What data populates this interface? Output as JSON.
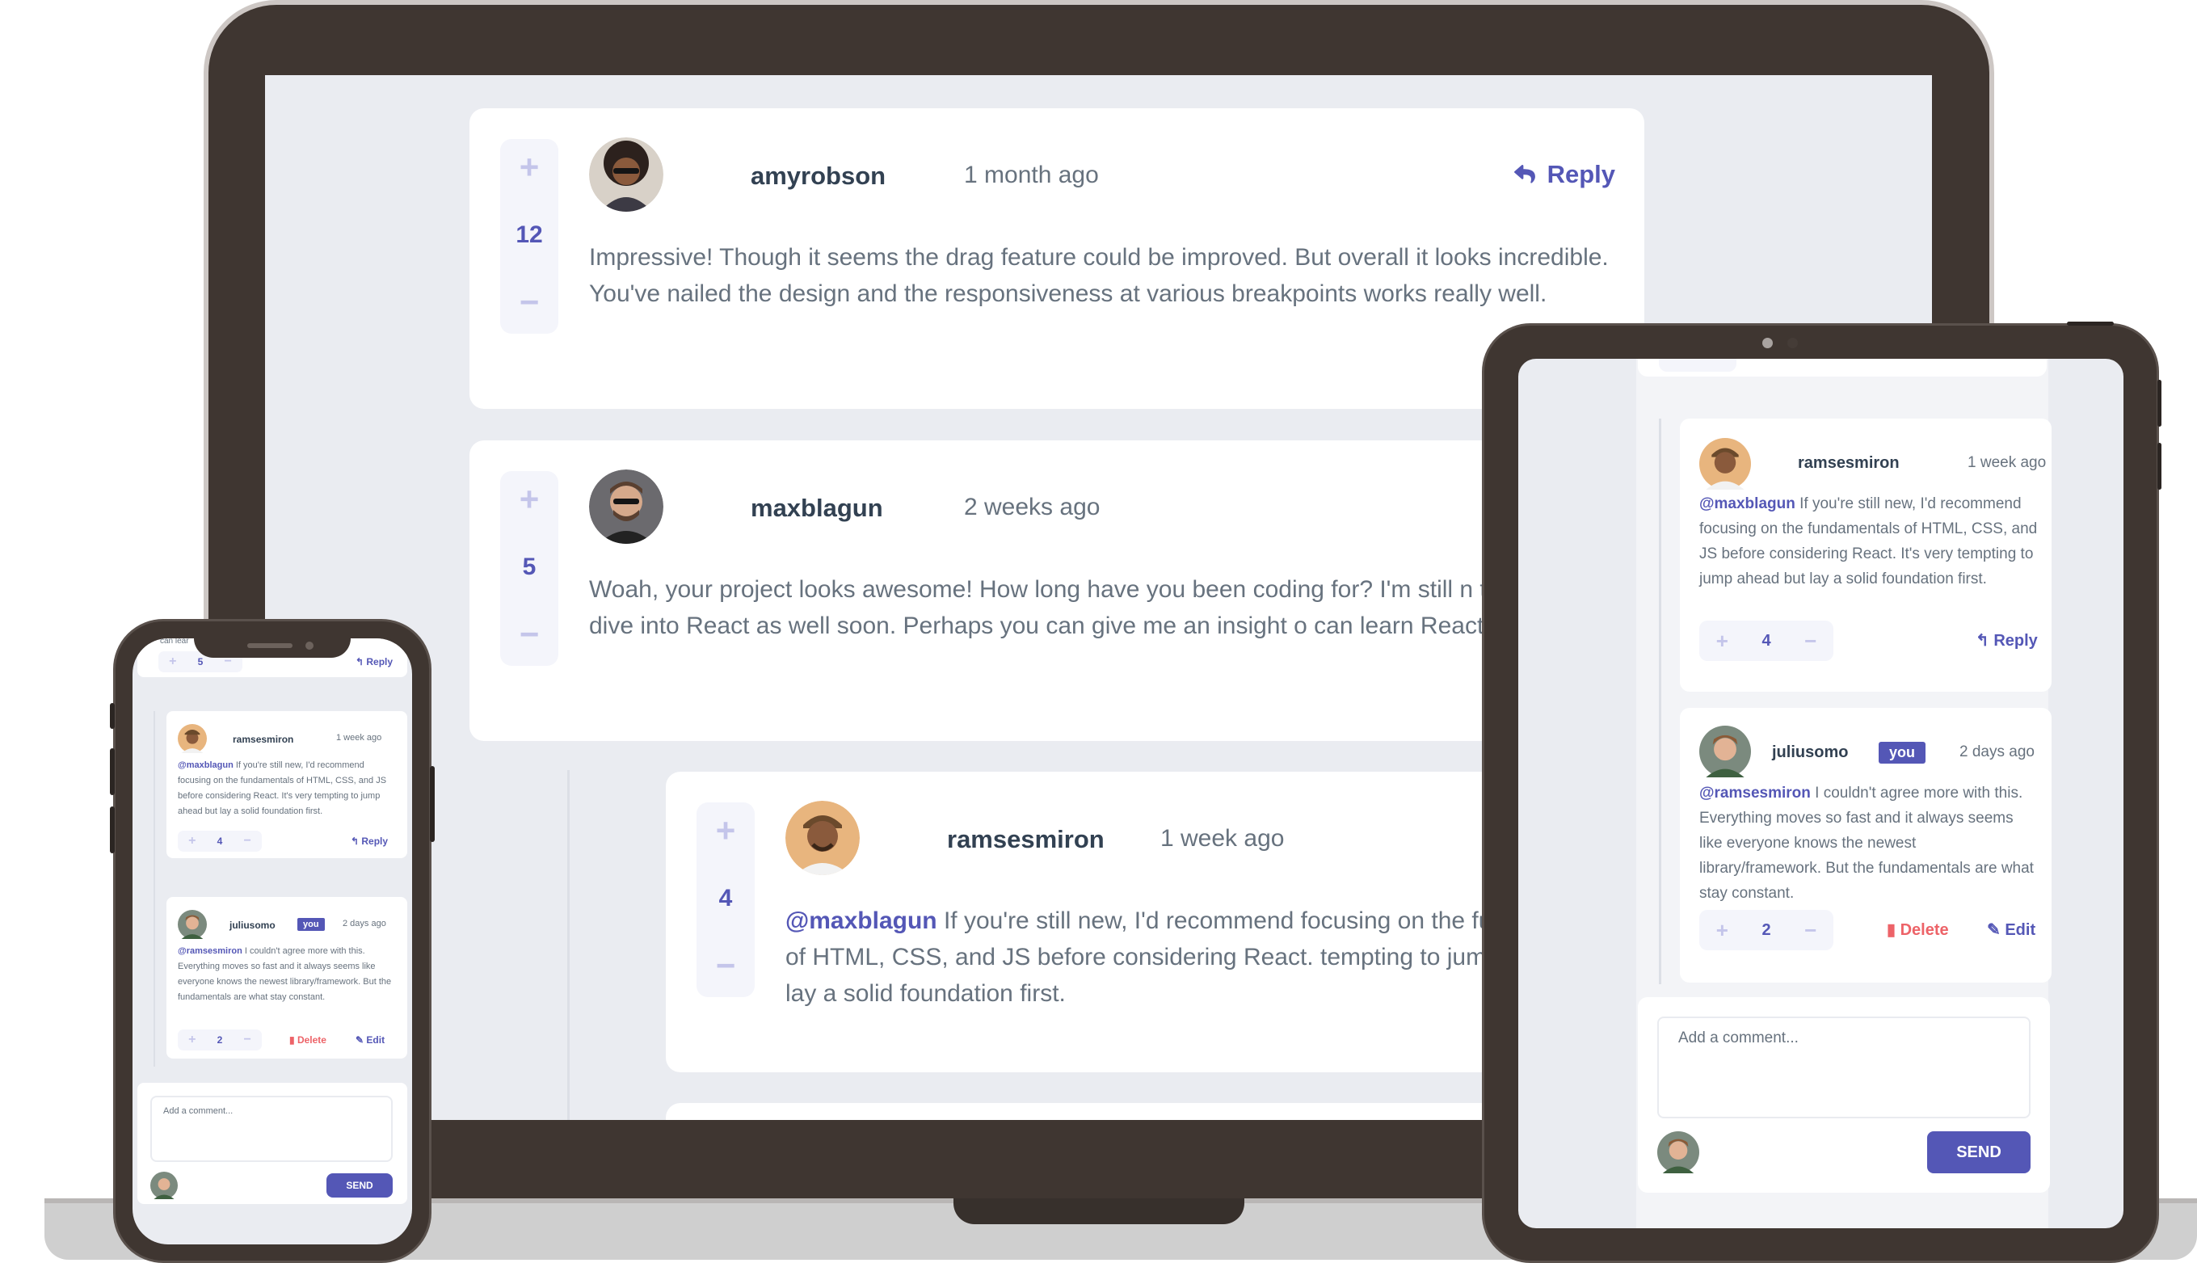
{
  "colors": {
    "primary": "#5457b6",
    "primary_light": "#c4c5ea",
    "danger": "#ed6368",
    "bg": "#eaecf1",
    "text": "#67727e",
    "heading": "#324152",
    "device_frame": "#3f3631"
  },
  "laptop": {
    "comments": [
      {
        "username": "amyrobson",
        "date": "1 month ago",
        "score": "12",
        "reply_label": "Reply",
        "text": "Impressive! Though it seems the drag feature could be improved. But overall it looks incredible. You've nailed the design and the responsiveness at various breakpoints works really well."
      },
      {
        "username": "maxblagun",
        "date": "2 weeks ago",
        "score": "5",
        "text": "Woah, your project looks awesome! How long have you been coding for? I'm still n think I want to dive into React as well soon. Perhaps you can give me an insight o can learn React? Thanks!"
      },
      {
        "username": "ramsesmiron",
        "date": "1 week ago",
        "score": "4",
        "mention": "@maxblagun",
        "text": "If you're still new, I'd recommend focusing on the fundamentals of HTML, CSS, and JS before considering React. tempting to jump ahead but lay a solid foundation first."
      }
    ]
  },
  "phone": {
    "top_fragment": "can lear",
    "top_score": "5",
    "top_reply": "Reply",
    "comments": [
      {
        "username": "ramsesmiron",
        "date": "1 week ago",
        "score": "4",
        "mention": "@maxblagun",
        "text": "If you're still new, I'd recommend focusing on the fundamentals of HTML, CSS, and JS before considering React. It's very tempting to jump ahead but lay a solid foundation first.",
        "reply_label": "Reply"
      },
      {
        "username": "juliusomo",
        "you_tag": "you",
        "date": "2 days ago",
        "score": "2",
        "mention": "@ramsesmiron",
        "text": "I couldn't agree more with this. Everything moves so fast and it always seems like everyone knows the newest library/framework. But the fundamentals are what stay constant.",
        "delete_label": "Delete",
        "edit_label": "Edit"
      }
    ],
    "composer": {
      "placeholder": "Add a comment...",
      "send_label": "SEND"
    }
  },
  "tablet": {
    "comments": [
      {
        "username": "ramsesmiron",
        "date": "1 week ago",
        "score": "4",
        "mention": "@maxblagun",
        "text": "If you're still new, I'd recommend focusing on the fundamentals of HTML, CSS, and JS before considering React. It's very tempting to jump ahead but lay a solid foundation first.",
        "reply_label": "Reply"
      },
      {
        "username": "juliusomo",
        "you_tag": "you",
        "date": "2 days ago",
        "score": "2",
        "mention": "@ramsesmiron",
        "text": "I couldn't agree more with this. Everything moves so fast and it always seems like everyone knows the newest library/framework. But the fundamentals are what stay constant.",
        "delete_label": "Delete",
        "edit_label": "Edit"
      }
    ],
    "composer": {
      "placeholder": "Add a comment...",
      "send_label": "SEND"
    }
  },
  "icons": {
    "reply": "reply-arrow-icon",
    "delete": "trash-icon",
    "edit": "pencil-icon",
    "plus": "plus-icon",
    "minus": "minus-icon"
  }
}
